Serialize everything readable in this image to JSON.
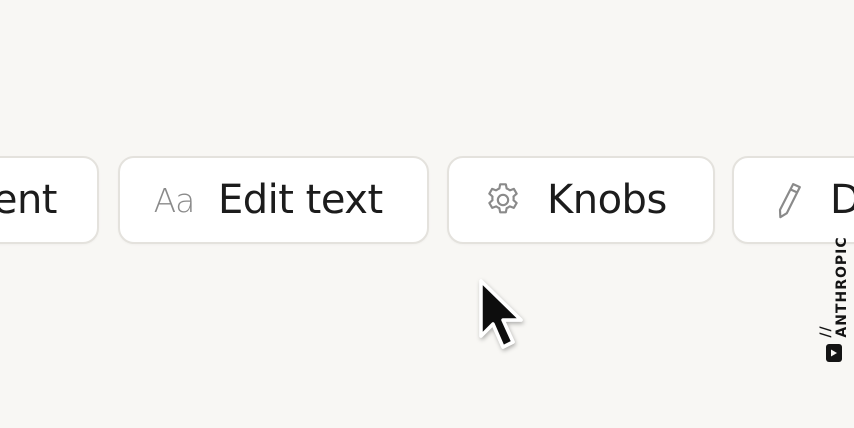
{
  "toolbar": {
    "chips": {
      "content": {
        "label": "ent"
      },
      "edit_text": {
        "icon_text": "Aa",
        "icon": "text-style-icon",
        "label": "Edit text"
      },
      "knobs": {
        "icon": "gear-icon",
        "label": "Knobs"
      },
      "draw": {
        "icon": "pencil-icon",
        "label": "D"
      }
    }
  },
  "watermark": {
    "text": "// ANTHROPIC",
    "icon": "play-badge-icon"
  },
  "cursor": {
    "icon": "mouse-pointer-icon"
  }
}
